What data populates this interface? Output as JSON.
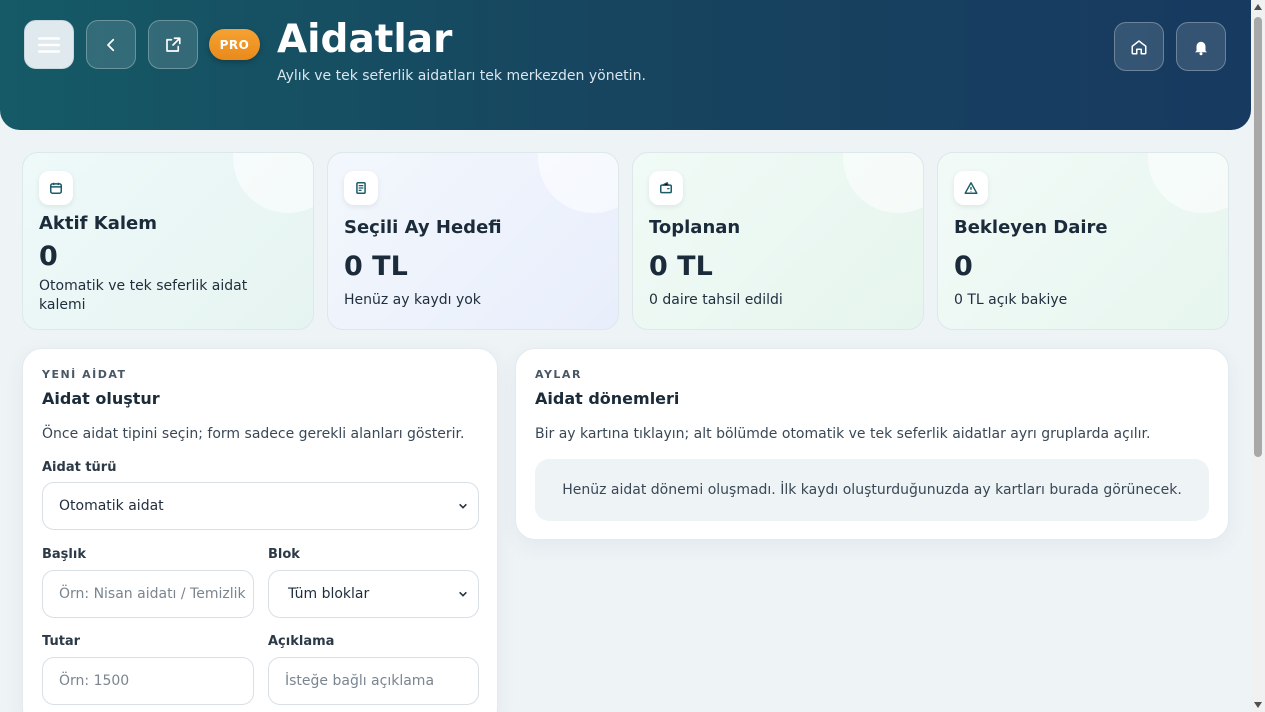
{
  "header": {
    "title": "Aidatlar",
    "subtitle": "Aylık ve tek seferlik aidatları tek merkezden yönetin.",
    "pro_badge": "PRO",
    "buttons": {
      "menu_icon": "menu-icon",
      "back_icon": "chevron-left-icon",
      "external_icon": "external-link-icon",
      "home_icon": "home-icon",
      "bell_icon": "bell-icon"
    }
  },
  "stats": [
    {
      "icon": "calendar-icon",
      "title": "Aktif Kalem",
      "value": "0",
      "description": "Otomatik ve tek seferlik aidat kalemi"
    },
    {
      "icon": "document-icon",
      "title": "Seçili Ay Hedefi",
      "value": "0 TL",
      "description": "Henüz ay kaydı yok"
    },
    {
      "icon": "wallet-icon",
      "title": "Toplanan",
      "value": "0 TL",
      "description": "0 daire tahsil edildi"
    },
    {
      "icon": "warning-icon",
      "title": "Bekleyen Daire",
      "value": "0",
      "description": "0 TL açık bakiye"
    }
  ],
  "new_dues": {
    "eyebrow": "YENİ AİDAT",
    "title": "Aidat oluştur",
    "description": "Önce aidat tipini seçin; form sadece gerekli alanları gösterir.",
    "type_label": "Aidat türü",
    "type_value": "Otomatik aidat",
    "title_label": "Başlık",
    "title_placeholder": "Örn: Nisan aidatı / Temizlik",
    "block_label": "Blok",
    "block_value": "Tüm bloklar",
    "amount_label": "Tutar",
    "amount_placeholder": "Örn: 1500",
    "note_label": "Açıklama",
    "note_placeholder": "İsteğe bağlı açıklama"
  },
  "months": {
    "eyebrow": "AYLAR",
    "title": "Aidat dönemleri",
    "description": "Bir ay kartına tıklayın; alt bölümde otomatik ve tek seferlik aidatlar ayrı gruplarda açılır.",
    "empty_message": "Henüz aidat dönemi oluşmadı. İlk kaydı oluşturduğunuzda ay kartları burada görünecek."
  },
  "colors": {
    "header_start": "#155a66",
    "header_end": "#173a60",
    "pro_badge": "#f09425",
    "icon_teal": "#1b5c68"
  }
}
